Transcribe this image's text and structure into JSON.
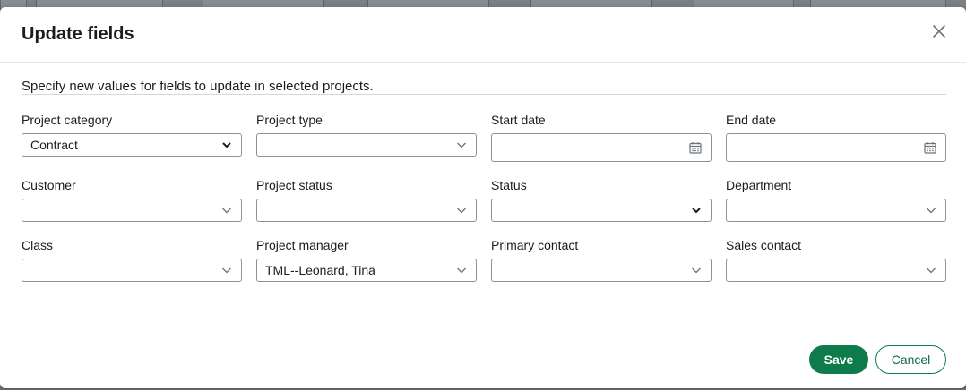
{
  "dialog": {
    "title": "Update fields",
    "instructions": "Specify new values for fields to update in selected projects."
  },
  "fields": {
    "project_category": {
      "label": "Project category",
      "value": "Contract"
    },
    "project_type": {
      "label": "Project type",
      "value": ""
    },
    "start_date": {
      "label": "Start date",
      "value": ""
    },
    "end_date": {
      "label": "End date",
      "value": ""
    },
    "customer": {
      "label": "Customer",
      "value": ""
    },
    "project_status": {
      "label": "Project status",
      "value": ""
    },
    "status": {
      "label": "Status",
      "value": ""
    },
    "department": {
      "label": "Department",
      "value": ""
    },
    "class": {
      "label": "Class",
      "value": ""
    },
    "project_manager": {
      "label": "Project manager",
      "value": "TML--Leonard, Tina"
    },
    "primary_contact": {
      "label": "Primary contact",
      "value": ""
    },
    "sales_contact": {
      "label": "Sales contact",
      "value": ""
    }
  },
  "buttons": {
    "save": "Save",
    "cancel": "Cancel"
  },
  "colors": {
    "primary": "#0f7a4a",
    "border": "#8a9399",
    "overlay": "#6e7478"
  }
}
